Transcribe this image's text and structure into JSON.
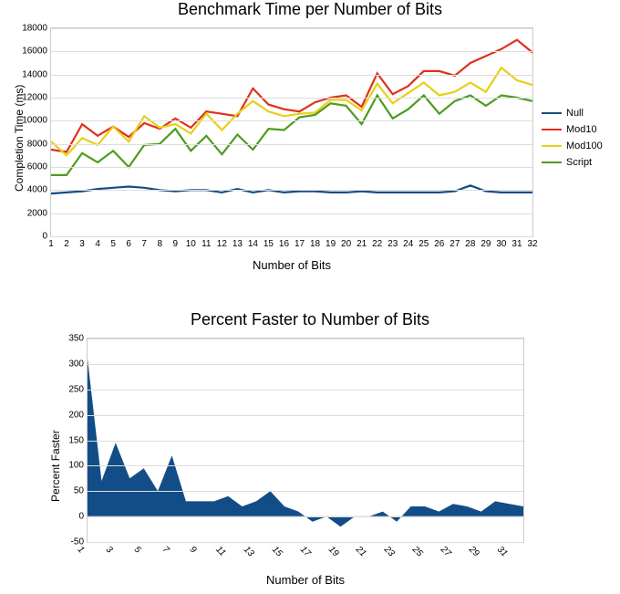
{
  "chart_data": [
    {
      "type": "line",
      "title": "Benchmark Time per Number of Bits",
      "xlabel": "Number of Bits",
      "ylabel": "Completion Time (ms)",
      "ylim": [
        0,
        18000
      ],
      "yticks": [
        0,
        2000,
        4000,
        6000,
        8000,
        10000,
        12000,
        14000,
        16000,
        18000
      ],
      "categories": [
        "1",
        "2",
        "3",
        "4",
        "5",
        "6",
        "7",
        "8",
        "9",
        "10",
        "11",
        "12",
        "13",
        "14",
        "15",
        "16",
        "17",
        "18",
        "19",
        "20",
        "21",
        "22",
        "23",
        "24",
        "25",
        "26",
        "27",
        "28",
        "29",
        "30",
        "31",
        "32"
      ],
      "series": [
        {
          "name": "Null",
          "color": "#124d87",
          "values": [
            3700,
            3800,
            3900,
            4100,
            4200,
            4300,
            4200,
            4000,
            3900,
            4000,
            4000,
            3800,
            4100,
            3800,
            4000,
            3800,
            3900,
            3900,
            3800,
            3800,
            3900,
            3800,
            3800,
            3800,
            3800,
            3800,
            3900,
            4400,
            3900,
            3800,
            3800,
            3800
          ]
        },
        {
          "name": "Mod10",
          "color": "#e1301a",
          "values": [
            7500,
            7300,
            9700,
            8700,
            9500,
            8600,
            9800,
            9300,
            10200,
            9400,
            10800,
            10600,
            10400,
            12800,
            11400,
            11000,
            10800,
            11600,
            12000,
            12200,
            11200,
            14100,
            12300,
            13000,
            14300,
            14300,
            13900,
            15000,
            15600,
            16200,
            17000,
            15900
          ]
        },
        {
          "name": "Mod100",
          "color": "#e8cf1a",
          "values": [
            8200,
            7000,
            8500,
            7900,
            9500,
            8200,
            10400,
            9400,
            9700,
            8900,
            10600,
            9200,
            10600,
            11700,
            10800,
            10400,
            10600,
            10700,
            11800,
            11800,
            10900,
            13200,
            11500,
            12400,
            13300,
            12200,
            12500,
            13300,
            12500,
            14600,
            13500,
            13100
          ]
        },
        {
          "name": "Script",
          "color": "#4d9c1f",
          "values": [
            5300,
            5300,
            7200,
            6400,
            7400,
            6000,
            7900,
            8000,
            9300,
            7400,
            8700,
            7100,
            8800,
            7500,
            9300,
            9200,
            10300,
            10500,
            11500,
            11300,
            9700,
            12200,
            10200,
            11000,
            12200,
            10600,
            11700,
            12200,
            11300,
            12200,
            12000,
            11700
          ]
        }
      ],
      "legend_position": "right"
    },
    {
      "type": "area",
      "title": "Percent Faster to Number of Bits",
      "xlabel": "Number of Bits",
      "ylabel": "Percent Faster",
      "ylim": [
        -50,
        350
      ],
      "yticks": [
        -50,
        0,
        50,
        100,
        150,
        200,
        250,
        300,
        350
      ],
      "categories": [
        "1",
        "2",
        "3",
        "4",
        "5",
        "6",
        "7",
        "8",
        "9",
        "10",
        "11",
        "12",
        "13",
        "14",
        "15",
        "16",
        "17",
        "18",
        "19",
        "20",
        "21",
        "22",
        "23",
        "24",
        "25",
        "26",
        "27",
        "28",
        "29",
        "30",
        "31",
        "32"
      ],
      "xticks_every_other": true,
      "series": [
        {
          "name": "Percent Faster",
          "color": "#124d87",
          "values": [
            310,
            70,
            145,
            75,
            95,
            50,
            120,
            30,
            30,
            30,
            40,
            20,
            30,
            50,
            20,
            10,
            -10,
            0,
            -20,
            0,
            0,
            10,
            -10,
            20,
            20,
            10,
            25,
            20,
            10,
            30,
            25,
            20
          ]
        }
      ]
    }
  ]
}
